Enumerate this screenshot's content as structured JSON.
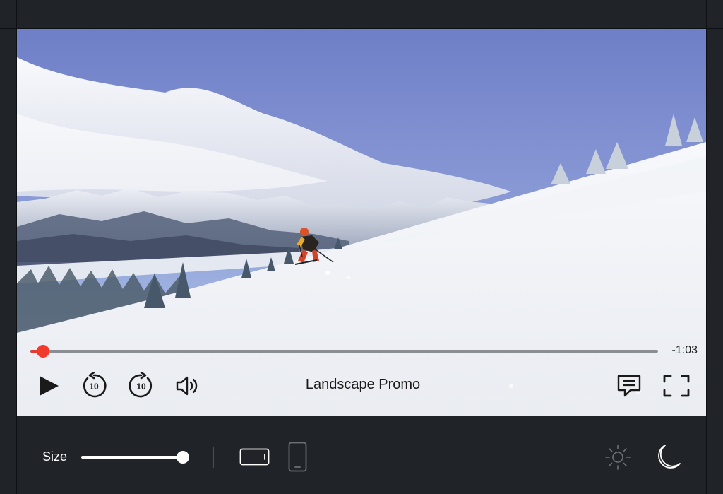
{
  "player": {
    "title": "Landscape Promo",
    "time_remaining": "-1:03",
    "progress": 0.02,
    "accent_color": "#f03a2e",
    "controls": {
      "play": "play-icon",
      "rewind": "rewind-10-icon",
      "forward": "forward-10-icon",
      "volume": "volume-icon",
      "captions": "captions-icon",
      "fullscreen": "fullscreen-icon"
    },
    "skip_seconds": "10"
  },
  "toolbar": {
    "size_label": "Size",
    "size_value": 0.97,
    "orientation": {
      "landscape": "landscape-device-icon",
      "portrait": "portrait-device-icon",
      "selected": "landscape"
    },
    "theme": {
      "light": "sun-icon",
      "dark": "moon-icon",
      "selected": "dark"
    }
  },
  "colors": {
    "frame_background": "#202327",
    "toolbar_text": "#ffffff",
    "control_icons": "#1a1a1a"
  }
}
